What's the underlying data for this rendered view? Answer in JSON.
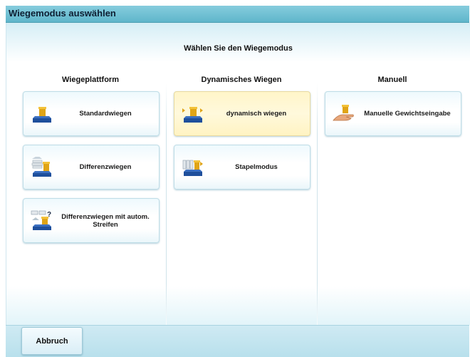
{
  "window": {
    "title": "Wiegemodus auswählen"
  },
  "prompt": "Wählen Sie den Wiegemodus",
  "columns": [
    {
      "header": "Wiegeplattform",
      "tiles": [
        {
          "label": "Standardwiegen",
          "icon": "scale-icon"
        },
        {
          "label": "Differenzwiegen",
          "icon": "mail-stack-scale-icon"
        },
        {
          "label": "Differenzwiegen mit autom. Streifen",
          "icon": "differential-tape-scale-icon"
        }
      ]
    },
    {
      "header": "Dynamisches Wiegen",
      "tiles": [
        {
          "label": "dynamisch wiegen",
          "icon": "dynamic-scale-icon",
          "selected": true
        },
        {
          "label": "Stapelmodus",
          "icon": "stack-mode-icon"
        }
      ]
    },
    {
      "header": "Manuell",
      "tiles": [
        {
          "label": "Manuelle Gewichtseingabe",
          "icon": "hand-weight-icon"
        }
      ]
    }
  ],
  "footer": {
    "cancel_label": "Abbruch"
  },
  "colors": {
    "title_bar": "#5fb6cb",
    "selected_tile": "#fff5c9",
    "footer": "#b8e0ec"
  }
}
